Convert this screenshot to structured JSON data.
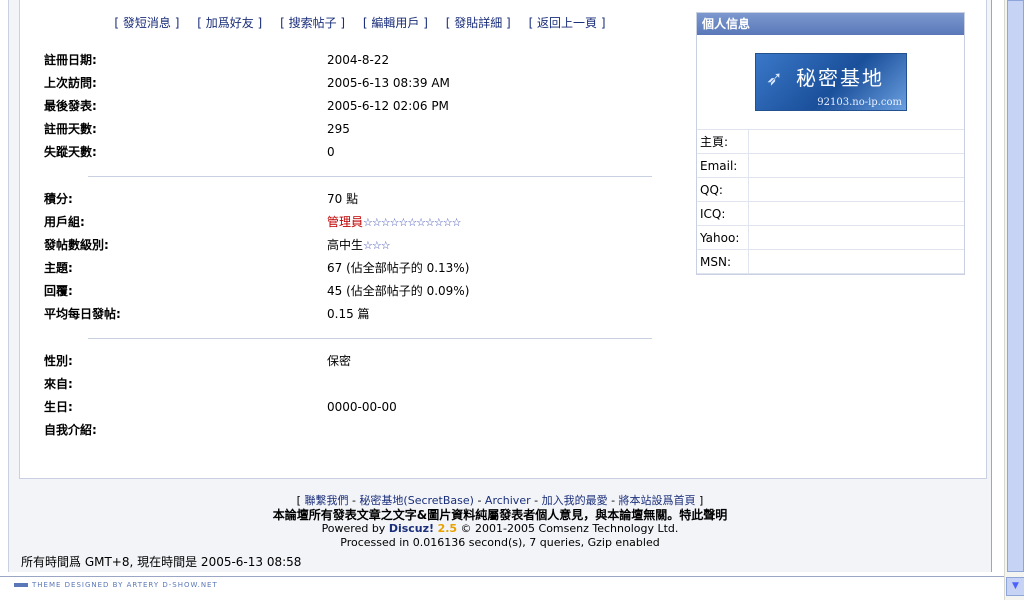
{
  "topnav": [
    "[ 發短消息 ]",
    "[ 加爲好友 ]",
    "[ 搜索帖子 ]",
    "[ 編輯用戶 ]",
    "[ 發貼詳細 ]",
    "[ 返回上一頁 ]"
  ],
  "profile": {
    "group1": [
      {
        "label": "註冊日期:",
        "value": "2004-8-22"
      },
      {
        "label": "上次訪問:",
        "value": "2005-6-13 08:39 AM"
      },
      {
        "label": "最後發表:",
        "value": "2005-6-12 02:06 PM"
      },
      {
        "label": "註冊天數:",
        "value": "295"
      },
      {
        "label": "失蹤天數:",
        "value": "0"
      }
    ],
    "group2": {
      "credits_label": "積分:",
      "credits_value": "70 點",
      "usergroup_label": "用戶組:",
      "usergroup_value": "管理員",
      "usergroup_stars": "☆☆☆☆☆☆☆☆☆☆☆",
      "postrank_label": "發帖數級別:",
      "postrank_value": "高中生",
      "postrank_stars": "☆☆☆",
      "threads_label": "主題:",
      "threads_value": "67 (佔全部帖子的 0.13%)",
      "replies_label": "回覆:",
      "replies_value": "45 (佔全部帖子的 0.09%)",
      "daily_label": "平均每日發帖:",
      "daily_value": "0.15 篇"
    },
    "group3": [
      {
        "label": "性別:",
        "value": "保密"
      },
      {
        "label": "來自:",
        "value": ""
      },
      {
        "label": "生日:",
        "value": "0000-00-00"
      },
      {
        "label": "自我介紹:",
        "value": ""
      }
    ]
  },
  "sidebar": {
    "title": "個人信息",
    "logo_text": "秘密基地",
    "logo_url": "92103.no-ip.com",
    "fields": [
      {
        "label": "主頁:",
        "value": ""
      },
      {
        "label": "Email:",
        "value": ""
      },
      {
        "label": "QQ:",
        "value": ""
      },
      {
        "label": "ICQ:",
        "value": ""
      },
      {
        "label": "Yahoo:",
        "value": ""
      },
      {
        "label": "MSN:",
        "value": ""
      }
    ]
  },
  "footer": {
    "link_open": "[",
    "contact": "聯繫我們",
    "site": "秘密基地(SecretBase)",
    "archiver": "Archiver",
    "favorite": "加入我的最愛",
    "homepage": "將本站設爲首頁",
    "link_close": "]",
    "dash": " - ",
    "disclaimer": "本論壇所有發表文章之文字&圖片資料純屬發表者個人意見，與本論壇無關。特此聲明",
    "powered_prefix": "Powered by ",
    "powered_name": "Discuz!",
    "powered_version": "2.5",
    "powered_suffix": " © 2001-2005 Comsenz Technology Ltd.",
    "processed": "Processed in 0.016136 second(s), 7 queries, Gzip enabled"
  },
  "timeline": "所有時間爲 GMT+8, 現在時間是 2005-6-13 08:58",
  "theme_credit": "THEME DESIGNED BY ARTERY D-SHOW.NET",
  "colors": {
    "accent": "#5a78b8",
    "link": "#1a2e7a",
    "admin": "#c00000",
    "star": "#3a4bb3"
  }
}
